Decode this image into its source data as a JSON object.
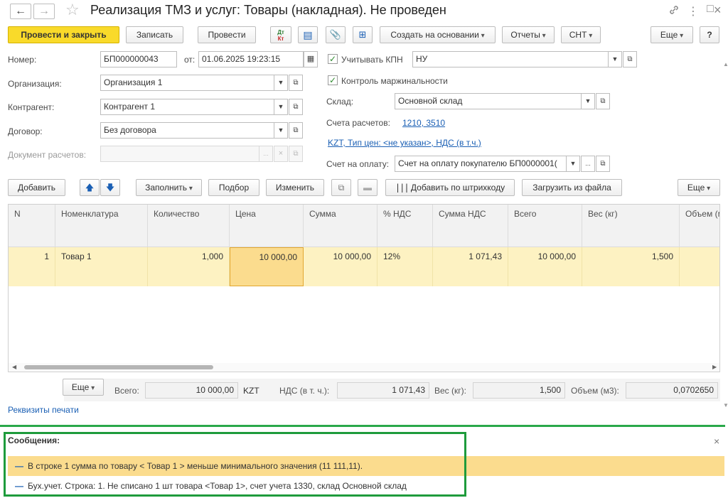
{
  "window": {
    "title": "Реализация ТМЗ и услуг: Товары (накладная). Не проведен",
    "back_icon": "←",
    "forward_icon": "→",
    "star_icon": "☆",
    "link_icon": "🔗",
    "more_icon": "⋮",
    "restore_icon": "□",
    "close_icon": "×"
  },
  "toolbar": {
    "post_close": "Провести и закрыть",
    "save": "Записать",
    "post": "Провести",
    "dt_kt": "Дт Кт",
    "create_based": "Создать на основании",
    "reports": "Отчеты",
    "snt": "СНТ",
    "more": "Еще",
    "help": "?"
  },
  "form": {
    "number_label": "Номер:",
    "number_value": "БП000000043",
    "date_label": "от:",
    "date_value": "01.06.2025 19:23:15",
    "kpn_label": "Учитывать КПН",
    "kpn_value": "НУ",
    "margin_label": "Контроль маржинальности",
    "org_label": "Организация:",
    "org_value": "Организация 1",
    "counterparty_label": "Контрагент:",
    "counterparty_value": "Контрагент 1",
    "contract_label": "Договор:",
    "contract_value": "Без договора",
    "settlement_doc_label": "Документ расчетов:",
    "settlement_doc_value": "",
    "warehouse_label": "Склад:",
    "warehouse_value": "Основной склад",
    "accounts_label": "Счета расчетов:",
    "accounts_link": "1210, 3510",
    "price_link": "KZT, Тип цен: <не указан>, НДС (в т.ч.)",
    "invoice_label": "Счет на оплату:",
    "invoice_value": "Счет на оплату покупателю БП0000001("
  },
  "table_toolbar": {
    "add": "Добавить",
    "fill": "Заполнить",
    "select": "Подбор",
    "change": "Изменить",
    "barcode": "Добавить по штрихкоду",
    "load_file": "Загрузить из файла",
    "more": "Еще"
  },
  "table": {
    "columns": [
      "N",
      "Номенклатура",
      "Количество",
      "Цена",
      "Сумма",
      "% НДС",
      "Сумма НДС",
      "Всего",
      "Вес (кг)",
      "Объем (м"
    ],
    "rows": [
      [
        "1",
        "Товар 1",
        "1,000",
        "10 000,00",
        "10 000,00",
        "12%",
        "1 071,43",
        "10 000,00",
        "1,500",
        ""
      ]
    ]
  },
  "totals": {
    "more": "Еще",
    "total_label": "Всего:",
    "total_value": "10 000,00",
    "currency": "KZT",
    "vat_label": "НДС (в т. ч.):",
    "vat_value": "1 071,43",
    "weight_label": "Вес (кг):",
    "weight_value": "1,500",
    "volume_label": "Объем (м3):",
    "volume_value": "0,0702650"
  },
  "print_link": "Реквизиты печати",
  "messages": {
    "title": "Сообщения:",
    "close": "×",
    "items": [
      "В строке 1 сумма по товару < Товар 1 > меньше минимального значения (11 111,11).",
      "Бух.учет. Строка: 1. Не списано 1 шт товара <Товар 1>, счет учета 1330, склад Основной склад"
    ]
  },
  "colors": {
    "accent_yellow": "#f9da2a",
    "row_highlight": "#fdf2c2",
    "selected_cell": "#fbdc8e",
    "link": "#1a5fb4",
    "message_border": "#1e9b3c",
    "separator": "#2aa84a"
  }
}
